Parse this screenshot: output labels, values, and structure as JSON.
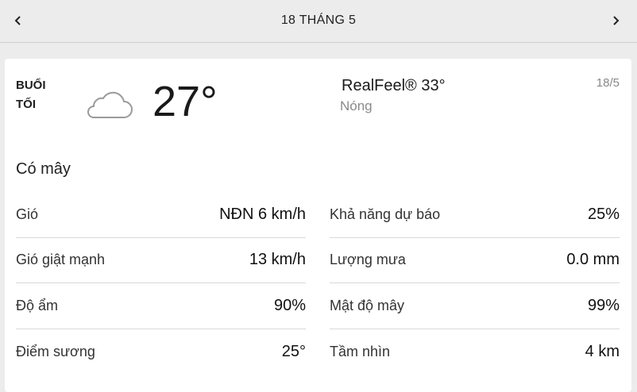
{
  "header": {
    "date_title": "18 THÁNG 5",
    "prev_icon": "chevron-left-icon",
    "next_icon": "chevron-right-icon"
  },
  "summary": {
    "period": "BUỔI TỐI",
    "weather_icon": "cloud-icon",
    "temperature": "27°",
    "realfeel": "RealFeel® 33°",
    "phrase": "Nóng",
    "short_date": "18/5"
  },
  "condition": "Có mây",
  "details": {
    "left": [
      {
        "label": "Gió",
        "value": "NĐN 6 km/h"
      },
      {
        "label": "Gió giật mạnh",
        "value": "13 km/h"
      },
      {
        "label": "Độ ẩm",
        "value": "90%"
      },
      {
        "label": "Điểm sương",
        "value": "25°"
      }
    ],
    "right": [
      {
        "label": "Khả năng dự báo",
        "value": "25%"
      },
      {
        "label": "Lượng mưa",
        "value": "0.0 mm"
      },
      {
        "label": "Mật độ mây",
        "value": "99%"
      },
      {
        "label": "Tầm nhìn",
        "value": "4 km"
      }
    ]
  },
  "colors": {
    "background": "#ececec",
    "card": "#ffffff",
    "muted_text": "#8a8a8a"
  }
}
